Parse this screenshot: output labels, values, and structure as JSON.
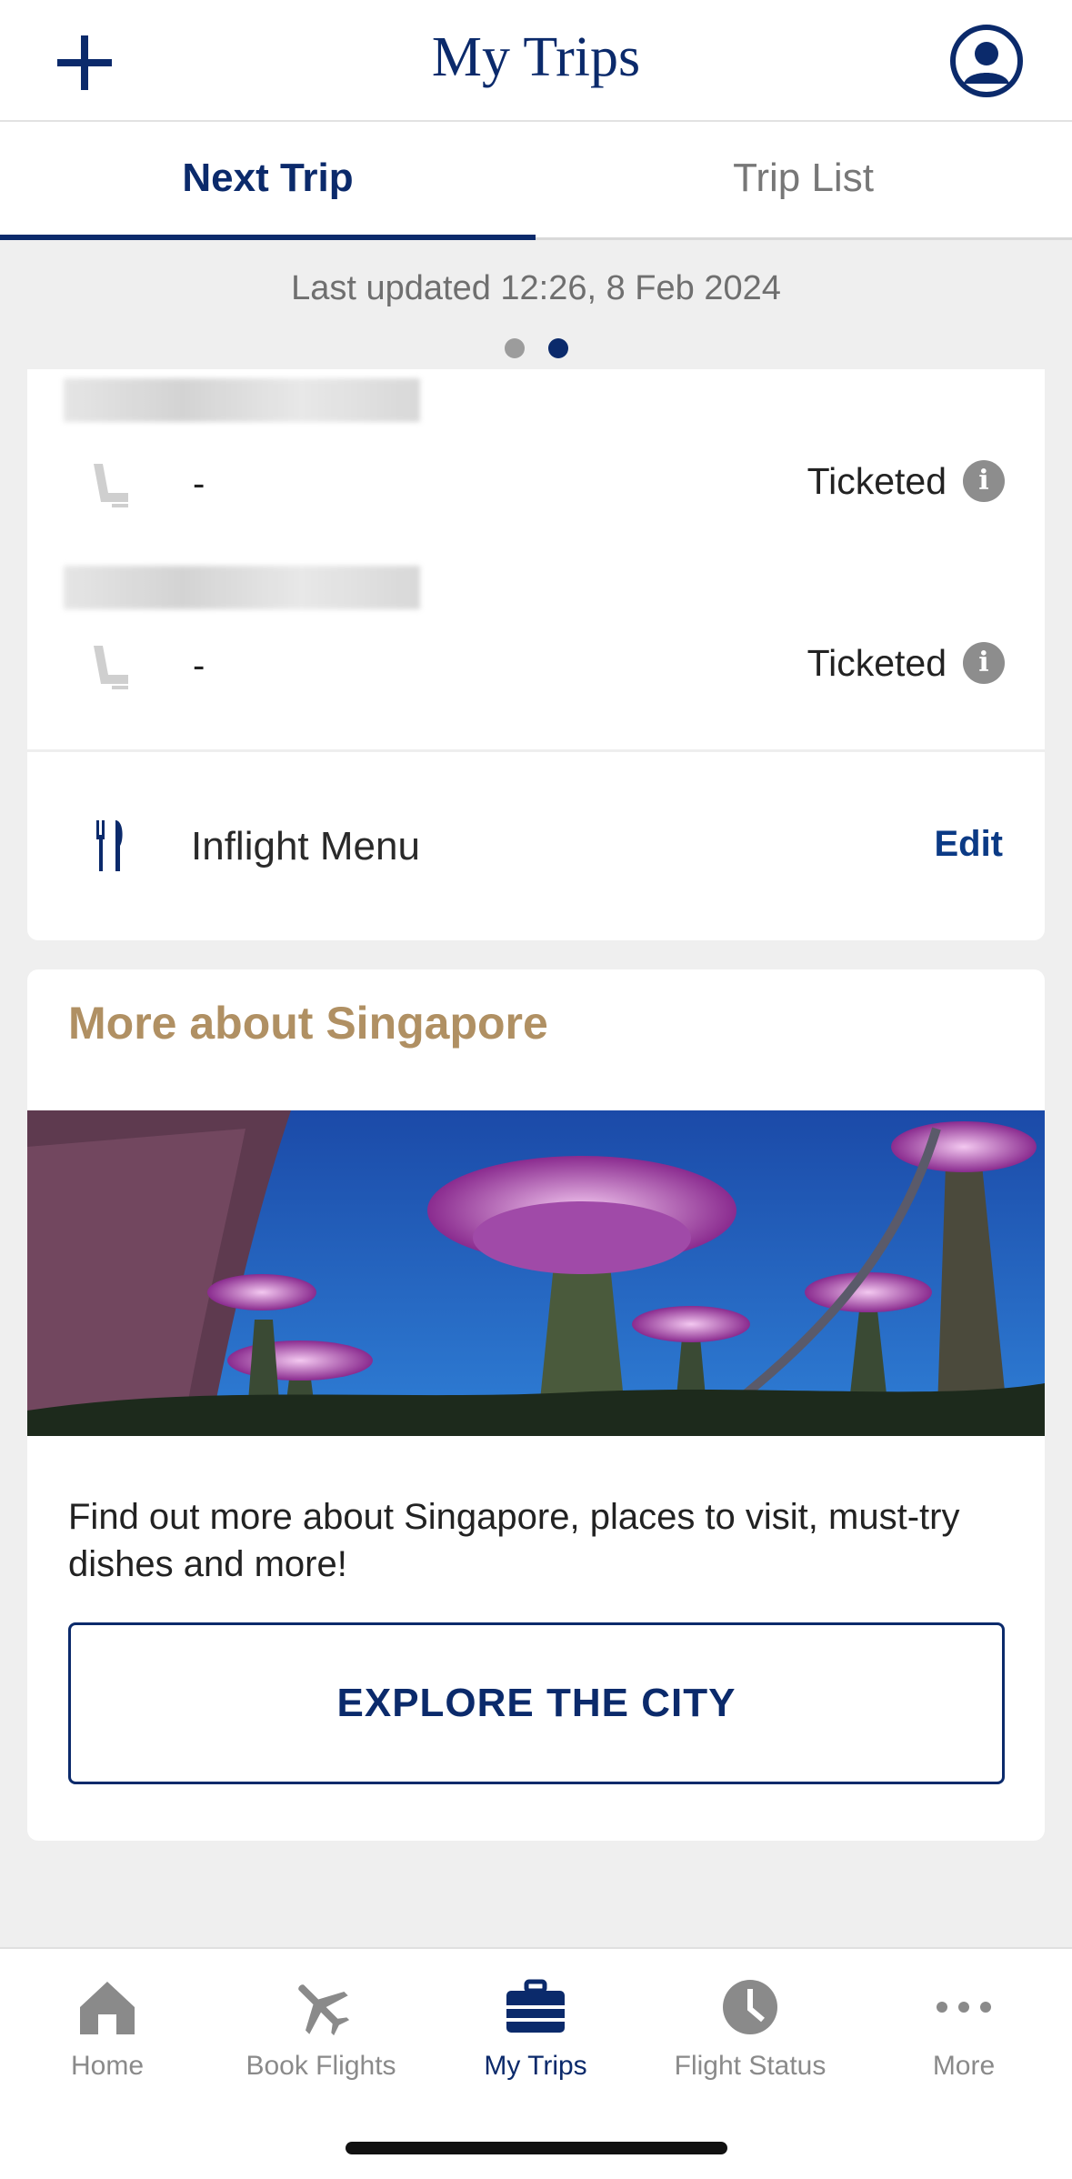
{
  "header": {
    "title": "My Trips"
  },
  "tabs": [
    {
      "label": "Next Trip",
      "active": true
    },
    {
      "label": "Trip List",
      "active": false
    }
  ],
  "last_updated": "Last updated 12:26, 8 Feb 2024",
  "pagination": {
    "current": 2,
    "total": 2
  },
  "passengers": [
    {
      "seat": "-",
      "status": "Ticketed"
    },
    {
      "seat": "-",
      "status": "Ticketed"
    }
  ],
  "inflight_menu": {
    "label": "Inflight Menu",
    "action": "Edit"
  },
  "destination_card": {
    "title": "More about Singapore",
    "description": "Find out more about Singapore, places to visit, must-try dishes and more!",
    "button_label": "EXPLORE THE CITY"
  },
  "bottom_nav": [
    {
      "label": "Home",
      "icon": "home-icon",
      "active": false
    },
    {
      "label": "Book Flights",
      "icon": "plane-icon",
      "active": false
    },
    {
      "label": "My Trips",
      "icon": "briefcase-icon",
      "active": true
    },
    {
      "label": "Flight Status",
      "icon": "clock-icon",
      "active": false
    },
    {
      "label": "More",
      "icon": "more-dots-icon",
      "active": false
    }
  ],
  "colors": {
    "brand_navy": "#0b2a6b",
    "gold": "#b09063",
    "background": "#efefef"
  }
}
